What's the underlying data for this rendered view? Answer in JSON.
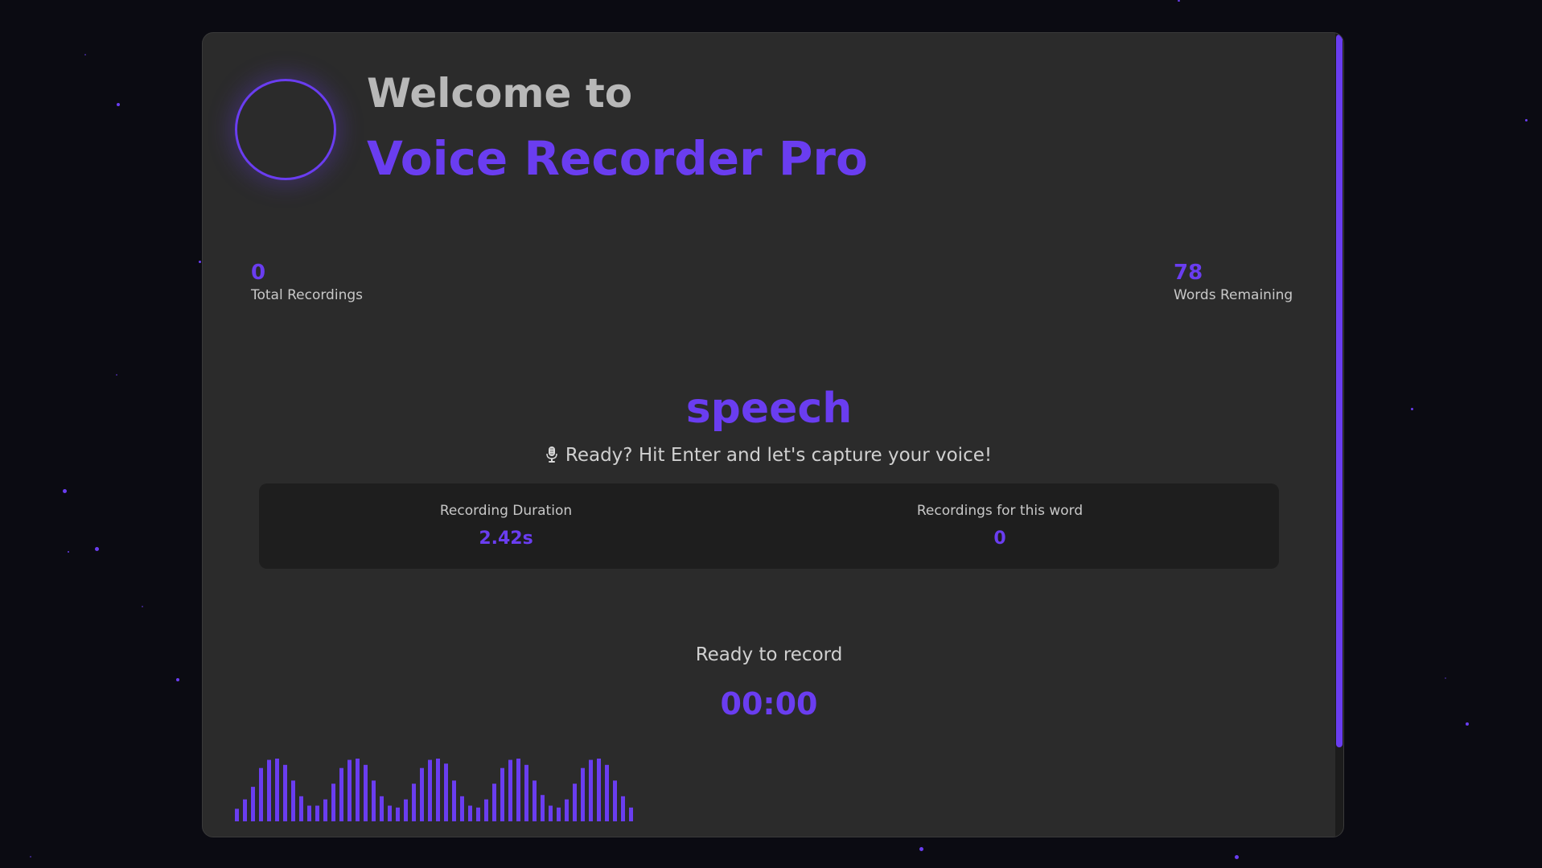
{
  "header": {
    "welcome": "Welcome to",
    "app_name": "Voice Recorder Pro"
  },
  "stats": {
    "total_recordings_value": "0",
    "total_recordings_label": "Total Recordings",
    "words_remaining_value": "78",
    "words_remaining_label": "Words Remaining"
  },
  "current_word": "speech",
  "prompt": "Ready? Hit Enter and let's capture your voice!",
  "info": {
    "duration_label": "Recording Duration",
    "duration_value": "2.42s",
    "word_recordings_label": "Recordings for this word",
    "word_recordings_value": "0"
  },
  "status": "Ready to record",
  "timer": "00:00",
  "colors": {
    "accent": "#6a3df0",
    "background": "#0b0b12",
    "card": "#2b2b2b",
    "panel": "#1e1e1e"
  },
  "icons": {
    "prompt_icon": "microphone-icon",
    "logo": "ring-logo-icon"
  },
  "waveform_levels": [
    0.2,
    0.35,
    0.55,
    0.85,
    0.98,
    1.0,
    0.9,
    0.65,
    0.4,
    0.25,
    0.25,
    0.35,
    0.6,
    0.85,
    0.98,
    1.0,
    0.9,
    0.65,
    0.4,
    0.25,
    0.22,
    0.35,
    0.6,
    0.85,
    0.98,
    1.0,
    0.92,
    0.65,
    0.4,
    0.25,
    0.22,
    0.35,
    0.6,
    0.85,
    0.98,
    1.0,
    0.9,
    0.65,
    0.42,
    0.25,
    0.22,
    0.35,
    0.6,
    0.85,
    0.98,
    1.0,
    0.9,
    0.65,
    0.4,
    0.22
  ]
}
